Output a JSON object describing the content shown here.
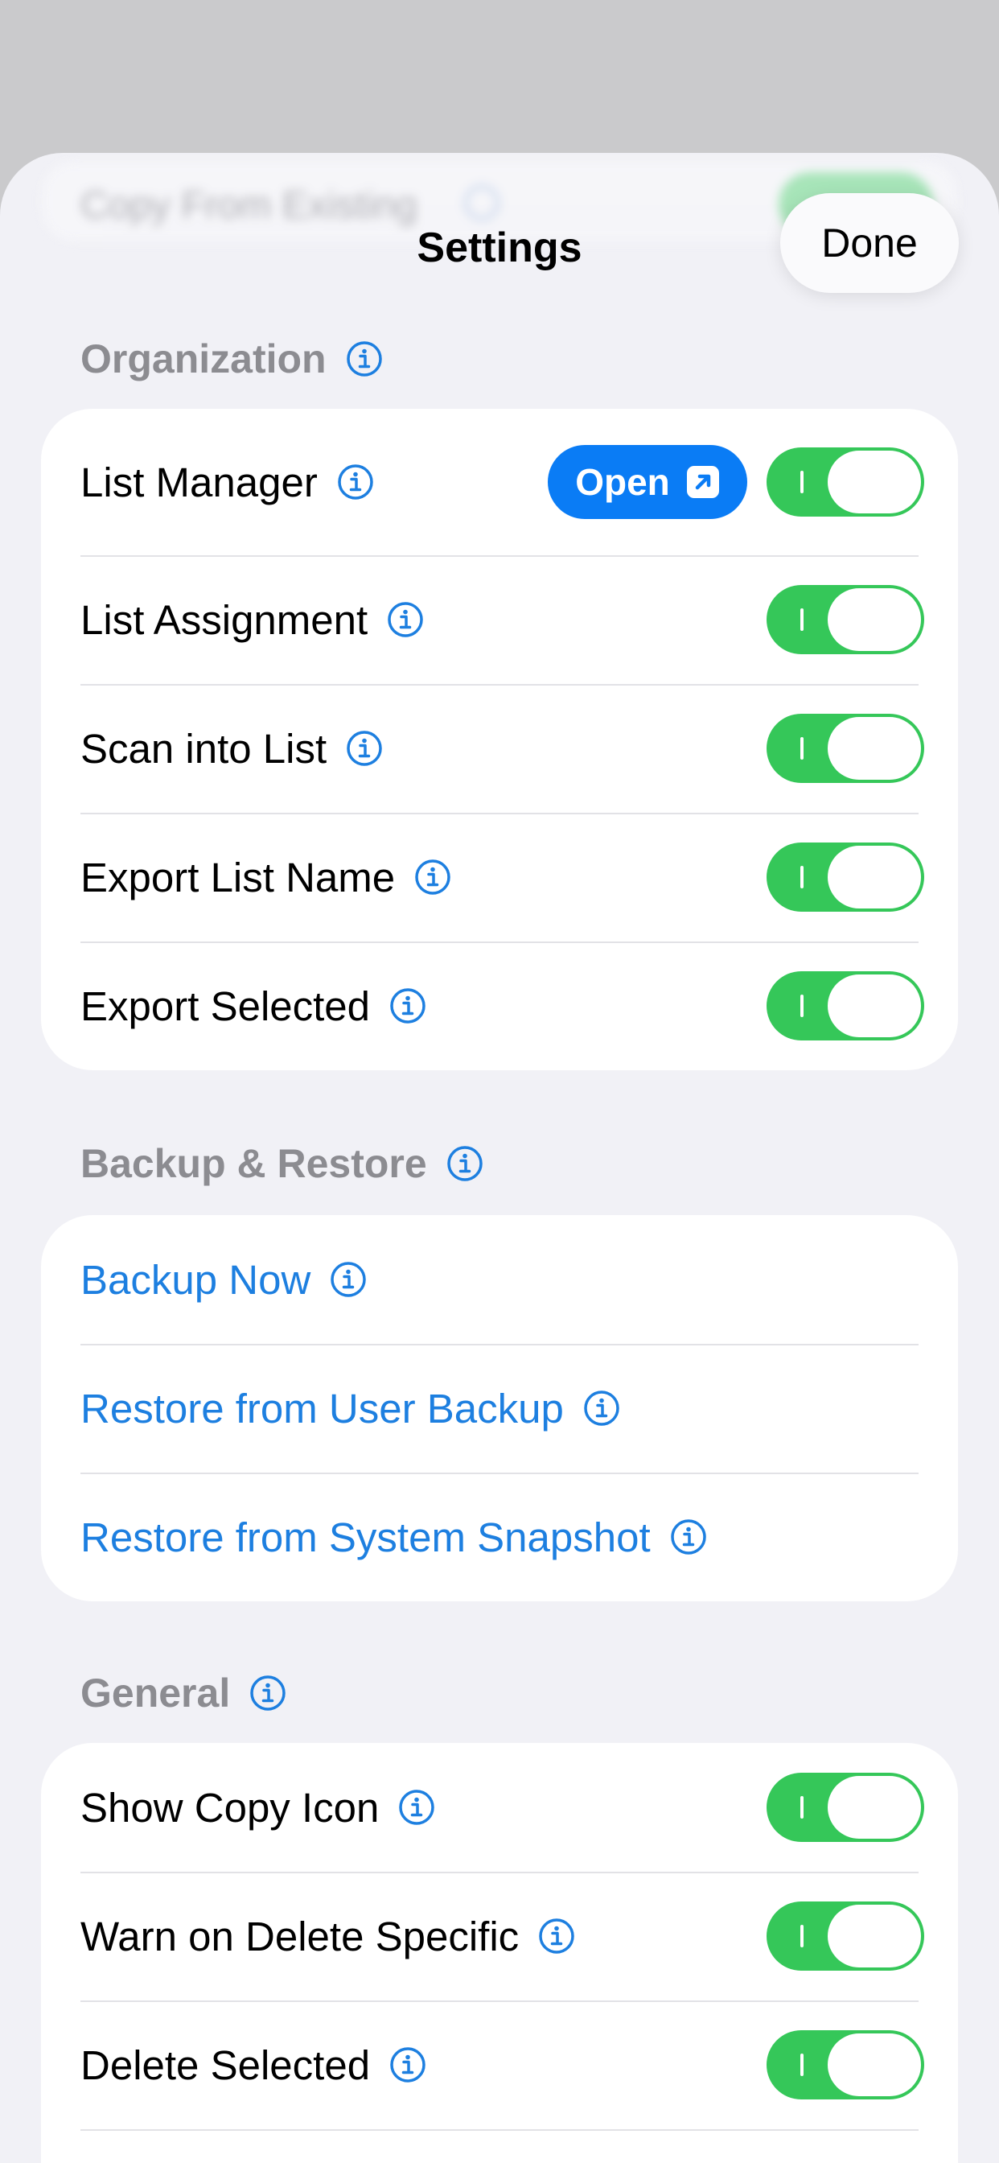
{
  "behind_row": {
    "label": "Copy From Existing",
    "toggle_on": true
  },
  "nav": {
    "title": "Settings",
    "done_label": "Done"
  },
  "sections": {
    "organization": {
      "title": "Organization",
      "open_label": "Open",
      "rows": [
        {
          "label": "List Manager",
          "toggle_on": true
        },
        {
          "label": "List Assignment",
          "toggle_on": true
        },
        {
          "label": "Scan into List",
          "toggle_on": true
        },
        {
          "label": "Export List Name",
          "toggle_on": true
        },
        {
          "label": "Export Selected",
          "toggle_on": true
        }
      ]
    },
    "backup": {
      "title": "Backup & Restore",
      "rows": [
        {
          "label": "Backup Now"
        },
        {
          "label": "Restore from User Backup"
        },
        {
          "label": "Restore from System Snapshot"
        }
      ]
    },
    "general": {
      "title": "General",
      "rows": [
        {
          "label": "Show Copy Icon",
          "toggle_on": true
        },
        {
          "label": "Warn on Delete Specific",
          "toggle_on": true
        },
        {
          "label": "Delete Selected",
          "toggle_on": true
        }
      ]
    }
  },
  "colors": {
    "accent": "#0a7cf5",
    "link": "#1d7fe0",
    "toggle_on": "#35c759",
    "section_header": "#8c8c91",
    "sheet_background": "#f1f1f6",
    "backdrop": "#cacacc"
  }
}
